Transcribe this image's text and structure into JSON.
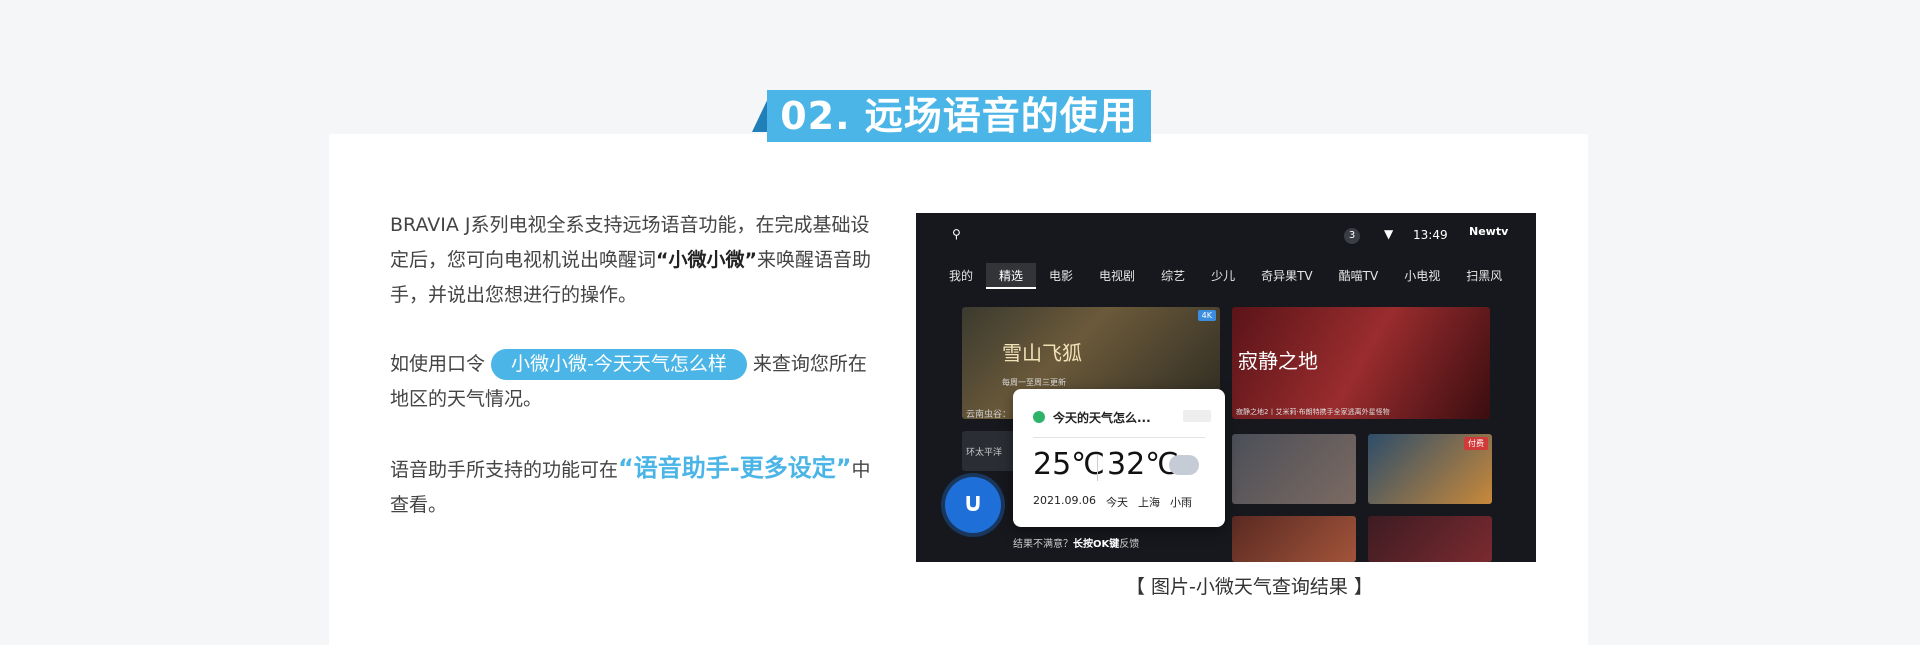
{
  "title": "02. 远场语音的使用",
  "paragraphs": {
    "p1_a": "BRAVIA J系列电视全系支持远场语音功能，在完成基础设定后，您可向电视机说出唤醒词",
    "p1_wake": "“小微小微”",
    "p1_b": "来唤醒语音助手，并说出您想进行的操作。",
    "p2_a": "如使用口令",
    "p2_cmd": "小微小微-今天天气怎么样",
    "p2_b": "来查询您所在地区的天气情况。",
    "p3_a": "语音助手所支持的功能可在",
    "p3_hl": "“语音助手-更多设定”",
    "p3_b": "中查看。"
  },
  "tv": {
    "top": {
      "badge": "3",
      "time": "13:49",
      "logo": "Newtv"
    },
    "nav": [
      "我的",
      "精选",
      "电影",
      "电视剧",
      "综艺",
      "少儿",
      "奇异果TV",
      "酷喵TV",
      "小电视",
      "扫黑风"
    ],
    "poster1": {
      "title": "雪山飞狐",
      "sub": "每周一至周三更新",
      "tag": "4K",
      "caption": "云南虫谷："
    },
    "poster2": {
      "title": "寂静之地",
      "caption": "寂静之地2丨艾米莉·布朗特携手全家逃离外星怪物"
    },
    "poster4": {
      "tag": "付费"
    },
    "side_label": "环太平洋",
    "weather": {
      "question": "今天的天气怎么...",
      "temp_low": "25℃",
      "temp_high": "32℃",
      "date": "2021.09.06",
      "day": "今天",
      "city": "上海",
      "condition": "小雨"
    },
    "feedback_a": "结果不满意？",
    "feedback_b": "长按OK键",
    "feedback_c": "反馈"
  },
  "caption": "【 图片-小微天气查询结果 】"
}
